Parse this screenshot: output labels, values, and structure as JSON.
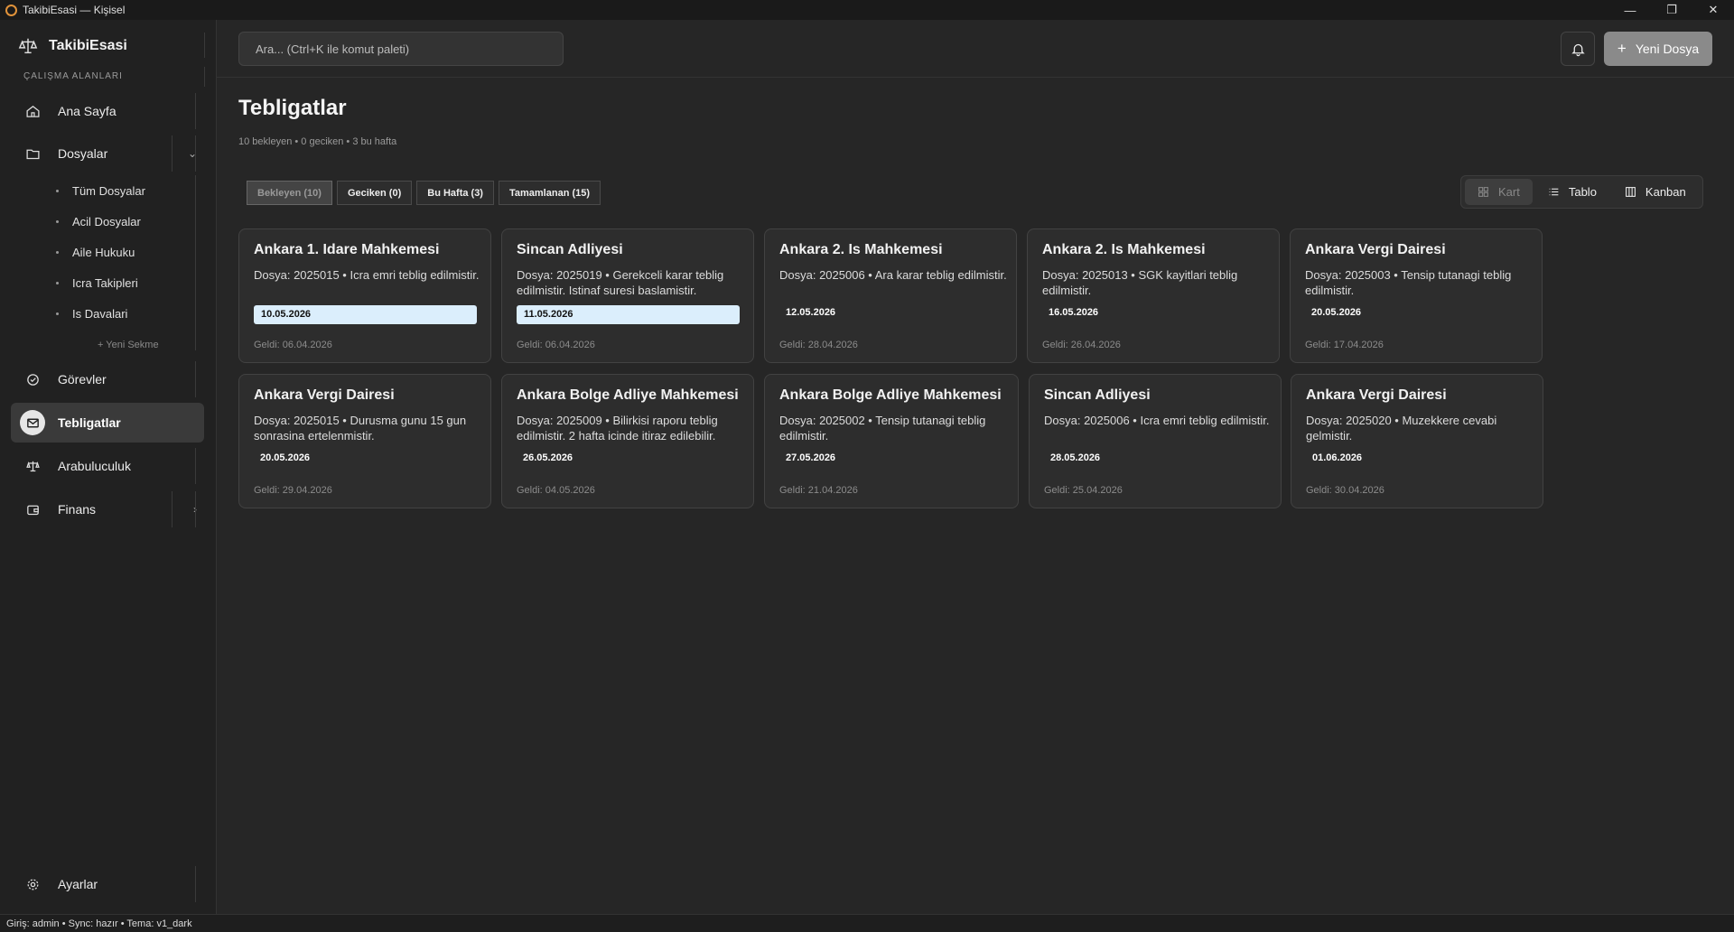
{
  "window": {
    "title": "TakibiEsasi — Kişisel"
  },
  "brand": {
    "name": "TakibiEsasi"
  },
  "sidebar": {
    "section_label": "ÇALIŞMA ALANLARI",
    "items": [
      {
        "label": "Ana Sayfa"
      },
      {
        "label": "Dosyalar"
      },
      {
        "label": "Görevler"
      },
      {
        "label": "Tebligatlar"
      },
      {
        "label": "Arabuluculuk"
      },
      {
        "label": "Finans"
      }
    ],
    "sub_items": [
      {
        "label": "Tüm Dosyalar"
      },
      {
        "label": "Acil Dosyalar"
      },
      {
        "label": "Aile Hukuku"
      },
      {
        "label": "Icra Takipleri"
      },
      {
        "label": "Is Davalari"
      }
    ],
    "new_tab": "+ Yeni Sekme",
    "settings": "Ayarlar"
  },
  "header": {
    "search_placeholder": "Ara...   (Ctrl+K ile komut paleti)",
    "new_file": "Yeni Dosya"
  },
  "page": {
    "title": "Tebligatlar",
    "subtitle": "10 bekleyen • 0 geciken • 3 bu hafta"
  },
  "filters": [
    {
      "label": "Bekleyen (10)",
      "active": true
    },
    {
      "label": "Geciken (0)"
    },
    {
      "label": "Bu Hafta (3)"
    },
    {
      "label": "Tamamlanan (15)"
    }
  ],
  "views": [
    {
      "label": "Kart",
      "active": true
    },
    {
      "label": "Tablo"
    },
    {
      "label": "Kanban"
    }
  ],
  "cards": [
    {
      "title": "Ankara 1. Idare Mahkemesi",
      "desc": "Dosya: 2025015  •  Icra emri teblig edilmistir.",
      "date": "10.05.2026",
      "highlight": true,
      "received": "Geldi: 06.04.2026"
    },
    {
      "title": "Sincan Adliyesi",
      "desc": "Dosya: 2025019  •  Gerekceli karar teblig edilmistir. Istinaf suresi baslamistir.",
      "date": "11.05.2026",
      "highlight": true,
      "received": "Geldi: 06.04.2026"
    },
    {
      "title": "Ankara 2. Is Mahkemesi",
      "desc": "Dosya: 2025006  •  Ara karar teblig edilmistir.",
      "date": "12.05.2026",
      "received": "Geldi: 28.04.2026"
    },
    {
      "title": "Ankara 2. Is Mahkemesi",
      "desc": "Dosya: 2025013  •  SGK kayitlari teblig edilmistir.",
      "date": "16.05.2026",
      "received": "Geldi: 26.04.2026"
    },
    {
      "title": "Ankara Vergi Dairesi",
      "desc": "Dosya: 2025003  •  Tensip tutanagi teblig edilmistir.",
      "date": "20.05.2026",
      "received": "Geldi: 17.04.2026"
    },
    {
      "title": "Ankara Vergi Dairesi",
      "desc": "Dosya: 2025015  •  Durusma gunu 15 gun sonrasina ertelenmistir.",
      "date": "20.05.2026",
      "received": "Geldi: 29.04.2026"
    },
    {
      "title": "Ankara Bolge Adliye Mahkemesi",
      "desc": "Dosya: 2025009  •  Bilirkisi raporu teblig edilmistir. 2 hafta icinde itiraz edilebilir.",
      "date": "26.05.2026",
      "received": "Geldi: 04.05.2026"
    },
    {
      "title": "Ankara Bolge Adliye Mahkemesi",
      "desc": "Dosya: 2025002  •  Tensip tutanagi teblig edilmistir.",
      "date": "27.05.2026",
      "received": "Geldi: 21.04.2026"
    },
    {
      "title": "Sincan Adliyesi",
      "desc": "Dosya: 2025006  •  Icra emri teblig edilmistir.",
      "date": "28.05.2026",
      "received": "Geldi: 25.04.2026"
    },
    {
      "title": "Ankara Vergi Dairesi",
      "desc": "Dosya: 2025020  •  Muzekkere cevabi gelmistir.",
      "date": "01.06.2026",
      "received": "Geldi: 30.04.2026"
    }
  ],
  "status": "Giriş: admin   •   Sync: hazır   •   Tema: v1_dark"
}
